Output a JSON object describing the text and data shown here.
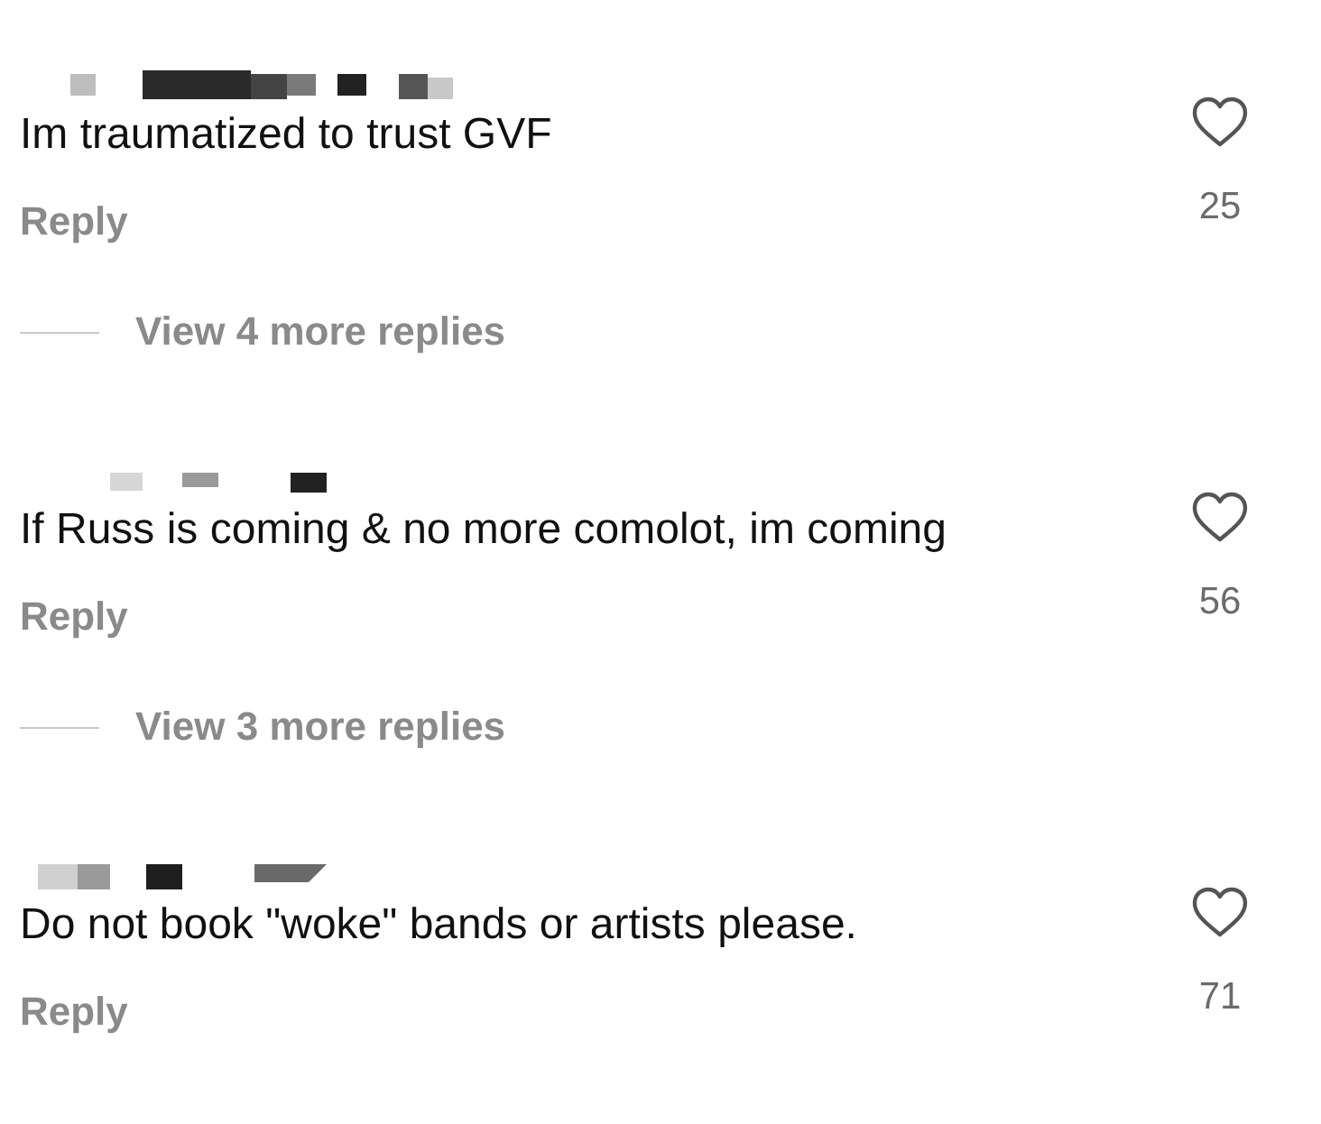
{
  "comments": [
    {
      "text": "Im traumatized to trust GVF",
      "reply": "Reply",
      "likes": "25",
      "more_replies": "View 4 more replies"
    },
    {
      "text": "If Russ is coming & no more comolot, im coming",
      "reply": "Reply",
      "likes": "56",
      "more_replies": "View 3 more replies"
    },
    {
      "text": "Do not book \"woke\" bands or artists please.",
      "reply": "Reply",
      "likes": "71"
    }
  ]
}
